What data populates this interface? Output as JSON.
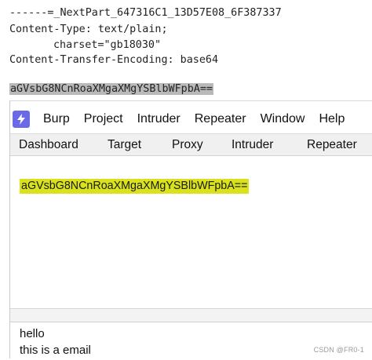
{
  "raw_email": {
    "lines": [
      "------=_NextPart_647316C1_13D57E08_6F387337",
      "Content-Type: text/plain;",
      "charset=\"gb18030\"",
      "Content-Transfer-Encoding: base64"
    ],
    "encoded_body": "aGVsbG8NCnRoaXMgaXMgYSBlbWFpbA=="
  },
  "app": {
    "menu": [
      "Burp",
      "Project",
      "Intruder",
      "Repeater",
      "Window",
      "Help"
    ],
    "tabs": [
      "Dashboard",
      "Target",
      "Proxy",
      "Intruder",
      "Repeater"
    ],
    "logo_icon": "burp-lightning-icon"
  },
  "decoder": {
    "input_text": "aGVsbG8NCnRoaXMgaXMgYSBlbWFpbA==",
    "highlight_color": "#d9e21a",
    "output_lines": [
      "hello",
      "this is a email"
    ]
  },
  "watermark": "CSDN @FR0-1"
}
